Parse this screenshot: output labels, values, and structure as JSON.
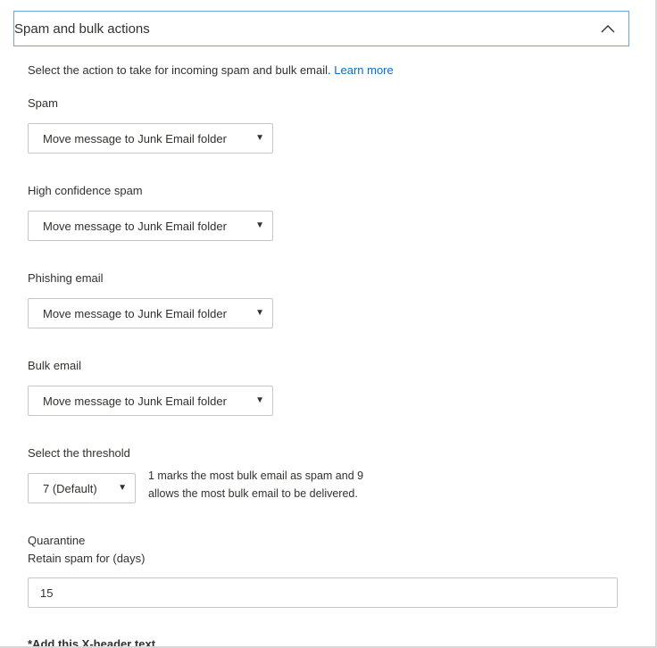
{
  "section": {
    "title": "Spam and bulk actions",
    "chevron_icon": "chevron-up-icon"
  },
  "description": {
    "text": "Select the action to take for incoming spam and bulk email.",
    "link": "Learn more"
  },
  "spam": {
    "label": "Spam",
    "value": "Move message to Junk Email folder"
  },
  "high_confidence_spam": {
    "label": "High confidence spam",
    "value": "Move message to Junk Email folder"
  },
  "phishing": {
    "label": "Phishing email",
    "value": "Move message to Junk Email folder"
  },
  "bulk": {
    "label": "Bulk email",
    "value": "Move message to Junk Email folder"
  },
  "threshold": {
    "label": "Select the threshold",
    "value": "7 (Default)",
    "help_line1": "1 marks the most bulk email as spam and 9",
    "help_line2": "allows the most bulk email to be delivered."
  },
  "quarantine": {
    "label": "Quarantine",
    "sublabel": "Retain spam for (days)",
    "value": "15"
  },
  "xheader": {
    "label": "*Add this X-header text"
  },
  "colors": {
    "accent": "#0a6ccc",
    "header_border": "#6fa4e0",
    "input_border": "#c8c6c4"
  }
}
